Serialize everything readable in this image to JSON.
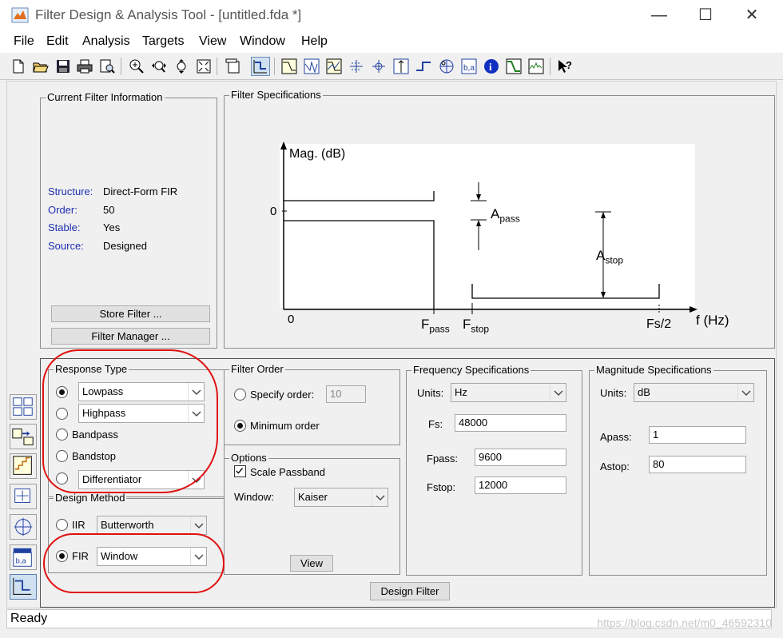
{
  "window": {
    "title": "Filter Design & Analysis Tool -  [untitled.fda *]",
    "minimize_glyph": "—",
    "maximize_glyph": "☐",
    "close_glyph": "✕"
  },
  "menu": [
    "File",
    "Edit",
    "Analysis",
    "Targets",
    "View",
    "Window",
    "Help"
  ],
  "toolbar_icons": [
    "new-icon",
    "open-icon",
    "save-icon",
    "print-icon",
    "print-preview-icon",
    "zoom-in-icon",
    "zoom-x-icon",
    "zoom-y-icon",
    "full-view-icon",
    "new-figure-icon",
    "filter-spec-icon",
    "magnitude-response-icon",
    "phase-response-icon",
    "magnitude-phase-icon",
    "group-delay-icon",
    "phase-delay-icon",
    "impulse-response-icon",
    "step-response-icon",
    "pole-zero-icon",
    "coefficients-icon",
    "info-icon",
    "magnitude-estimate-icon",
    "round-off-noise-icon",
    "whats-this-icon"
  ],
  "current_filter": {
    "title": "Current Filter Information",
    "rows": [
      {
        "label": "Structure:",
        "value": "Direct-Form FIR"
      },
      {
        "label": "Order:",
        "value": "50"
      },
      {
        "label": "Stable:",
        "value": "Yes"
      },
      {
        "label": "Source:",
        "value": "Designed"
      }
    ],
    "store_button": "Store Filter ...",
    "manager_button": "Filter Manager ..."
  },
  "filter_spec": {
    "title": "Filter Specifications",
    "mag_label": "Mag. (dB)",
    "y_zero": "0",
    "x_zero": "0",
    "f_axis": "f (Hz)",
    "fpass_main": "F",
    "fpass_sub": "pass",
    "fstop_main": "F",
    "fstop_sub": "stop",
    "fs2": "Fs/2",
    "apass_main": "A",
    "apass_sub": "pass",
    "astop_main": "A",
    "astop_sub": "stop"
  },
  "response_type": {
    "title": "Response Type",
    "lowpass": "Lowpass",
    "highpass": "Highpass",
    "bandpass": "Bandpass",
    "bandstop": "Bandstop",
    "differentiator": "Differentiator",
    "selected": "Lowpass"
  },
  "design_method": {
    "title": "Design Method",
    "iir_label": "IIR",
    "iir_value": "Butterworth",
    "fir_label": "FIR",
    "fir_value": "Window",
    "selected": "FIR"
  },
  "filter_order": {
    "title": "Filter Order",
    "specify_label": "Specify order:",
    "specify_value": "10",
    "minimum_label": "Minimum order",
    "selected": "Minimum order"
  },
  "options": {
    "title": "Options",
    "scale_passband": "Scale Passband",
    "scale_checked": true,
    "window_label": "Window:",
    "window_value": "Kaiser",
    "view_button": "View"
  },
  "freq_spec": {
    "title": "Frequency Specifications",
    "units_label": "Units:",
    "units_value": "Hz",
    "fs_label": "Fs:",
    "fs_value": "48000",
    "fpass_label": "Fpass:",
    "fpass_value": "9600",
    "fstop_label": "Fstop:",
    "fstop_value": "12000"
  },
  "mag_spec": {
    "title": "Magnitude Specifications",
    "units_label": "Units:",
    "units_value": "dB",
    "apass_label": "Apass:",
    "apass_value": "1",
    "astop_label": "Astop:",
    "astop_value": "80"
  },
  "design_button": "Design Filter",
  "status": "Ready",
  "watermark": "https://blog.csdn.net/m0_46592310",
  "annotation_color": "#e01010"
}
